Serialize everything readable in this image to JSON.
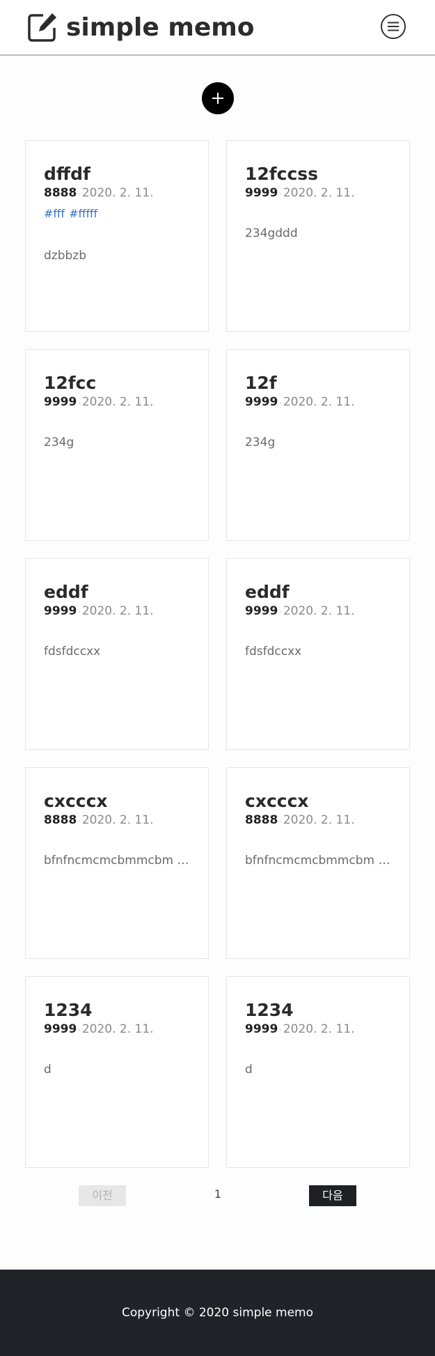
{
  "header": {
    "logo_icon": "edit-icon",
    "app_title": "simple memo",
    "menu_icon": "menu-icon"
  },
  "add_button": {
    "icon": "plus-icon"
  },
  "memos": [
    {
      "title": "dffdf",
      "author": "8888",
      "separator": "·",
      "date": "2020. 2. 11.",
      "tags": [
        "#fff",
        "#fffff"
      ],
      "body": "dzbbzb"
    },
    {
      "title": "12fccss",
      "author": "9999",
      "separator": "·",
      "date": "2020. 2. 11.",
      "tags": [],
      "body": "234gddd"
    },
    {
      "title": "12fcc",
      "author": "9999",
      "separator": "·",
      "date": "2020. 2. 11.",
      "tags": [],
      "body": "234g"
    },
    {
      "title": "12f",
      "author": "9999",
      "separator": "·",
      "date": "2020. 2. 11.",
      "tags": [],
      "body": "234g"
    },
    {
      "title": "eddf",
      "author": "9999",
      "separator": "·",
      "date": "2020. 2. 11.",
      "tags": [],
      "body": "fdsfdccxx"
    },
    {
      "title": "eddf",
      "author": "9999",
      "separator": "·",
      "date": "2020. 2. 11.",
      "tags": [],
      "body": "fdsfdccxx"
    },
    {
      "title": "cxcccx",
      "author": "8888",
      "separator": "·",
      "date": "2020. 2. 11.",
      "tags": [],
      "body": "bfnfncmcmcbmmcbm d..."
    },
    {
      "title": "cxcccx",
      "author": "8888",
      "separator": "·",
      "date": "2020. 2. 11.",
      "tags": [],
      "body": "bfnfncmcmcbmmcbm d..."
    },
    {
      "title": "1234",
      "author": "9999",
      "separator": "·",
      "date": "2020. 2. 11.",
      "tags": [],
      "body": "d"
    },
    {
      "title": "1234",
      "author": "9999",
      "separator": "·",
      "date": "2020. 2. 11.",
      "tags": [],
      "body": "d"
    }
  ],
  "pagination": {
    "prev_label": "이전",
    "current_page": "1",
    "next_label": "다음"
  },
  "footer": {
    "copyright": "Copyright © 2020 simple memo"
  },
  "colors": {
    "accent": "#000000",
    "tag": "#3a73c4",
    "footer_bg": "#212329"
  }
}
